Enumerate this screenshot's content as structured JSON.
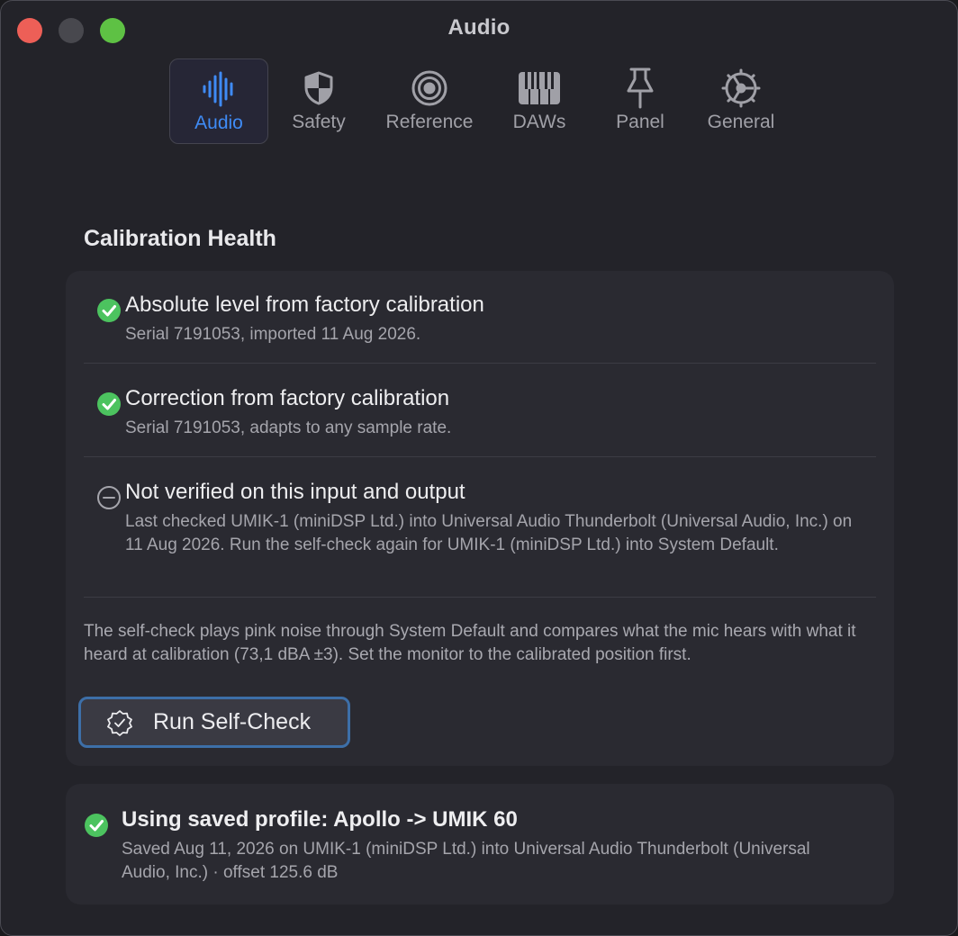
{
  "window": {
    "title": "Audio"
  },
  "tabs": [
    {
      "label": "Audio",
      "icon": "waveform-icon",
      "active": true
    },
    {
      "label": "Safety",
      "icon": "shield-icon",
      "active": false
    },
    {
      "label": "Reference",
      "icon": "target-icon",
      "active": false
    },
    {
      "label": "DAWs",
      "icon": "piano-keys-icon",
      "active": false
    },
    {
      "label": "Panel",
      "icon": "pin-icon",
      "active": false
    },
    {
      "label": "General",
      "icon": "gear-icon",
      "active": false
    }
  ],
  "calibration": {
    "title": "Calibration Health",
    "items": [
      {
        "status": "ok",
        "title": "Absolute level from factory calibration",
        "detail": "Serial 7191053, imported 11 Aug 2026."
      },
      {
        "status": "ok",
        "title": "Correction from factory calibration",
        "detail": "Serial 7191053, adapts to any sample rate."
      },
      {
        "status": "unverified",
        "title": "Not verified on this input and output",
        "detail": "Last checked UMIK-1 (miniDSP Ltd.) into Universal Audio Thunderbolt (Universal Audio, Inc.) on 11 Aug 2026. Run the self-check again for UMIK-1 (miniDSP Ltd.) into System Default."
      }
    ],
    "note": "The self-check plays pink noise through System Default and compares what the mic hears with what it heard at calibration (73,1 dBA ±3). Set the monitor to the calibrated position first.",
    "button_label": "Run Self-Check"
  },
  "profile": {
    "status": "ok",
    "title": "Using saved profile: Apollo -> UMIK 60",
    "detail": "Saved Aug 11, 2026 on UMIK-1 (miniDSP Ltd.) into Universal Audio Thunderbolt (Universal Audio, Inc.) · offset 125.6 dB"
  },
  "colors": {
    "accent": "#3f8bf5",
    "ok_green": "#4cc35f",
    "window_bg": "#232329",
    "card_bg": "#2a2a31",
    "button_focus_ring": "#3d6fa8"
  }
}
